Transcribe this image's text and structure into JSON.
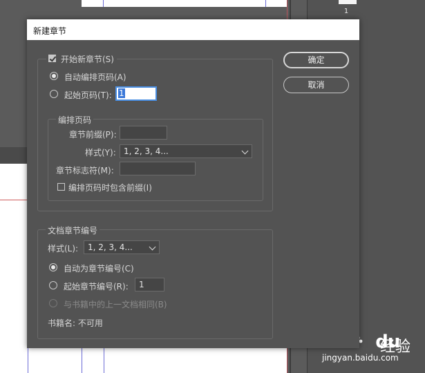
{
  "workspace": {
    "pages_panel": {
      "page_number": "1"
    },
    "watermark": {
      "logo_text": "Bai",
      "logo_text_2": "du",
      "cn_text": "经验",
      "url": "jingyan.baidu.com"
    }
  },
  "dialog": {
    "title": "新建章节",
    "start_section": {
      "label": "开始新章节(S)",
      "checked": true
    },
    "auto_page": {
      "label": "自动编排页码(A)",
      "selected": true
    },
    "start_page": {
      "label": "起始页码(T):",
      "value": "1"
    },
    "page_numbering": {
      "legend": "编排页码",
      "prefix_label": "章节前缀(P):",
      "prefix_value": "",
      "style_label": "样式(Y):",
      "style_value": "1, 2, 3, 4...",
      "marker_label": "章节标志符(M):",
      "marker_value": "",
      "include_prefix_label": "编排页码时包含前缀(I)",
      "include_prefix_checked": false
    },
    "chapter_numbering": {
      "legend": "文档章节编号",
      "style_label": "样式(L):",
      "style_value": "1, 2, 3, 4...",
      "auto_label": "自动为章节编号(C)",
      "start_label": "起始章节编号(R):",
      "start_value": "1",
      "same_label": "与书籍中的上一文档相同(B)",
      "book_name_label": "书籍名: 不可用"
    },
    "buttons": {
      "ok": "确定",
      "cancel": "取消"
    }
  }
}
